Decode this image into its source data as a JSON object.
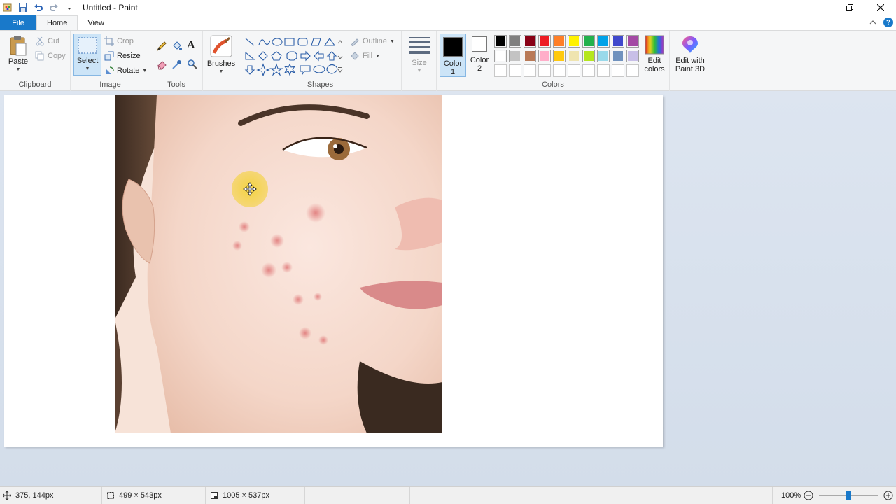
{
  "window": {
    "title": "Untitled - Paint"
  },
  "tabs": {
    "file": "File",
    "home": "Home",
    "view": "View"
  },
  "clipboard": {
    "label": "Clipboard",
    "paste": "Paste",
    "cut": "Cut",
    "copy": "Copy"
  },
  "image": {
    "label": "Image",
    "select": "Select",
    "crop": "Crop",
    "resize": "Resize",
    "rotate": "Rotate"
  },
  "tools": {
    "label": "Tools"
  },
  "brushes": {
    "label": "Brushes"
  },
  "shapes": {
    "label": "Shapes",
    "outline": "Outline",
    "fill": "Fill"
  },
  "size": {
    "label": "Size"
  },
  "colors": {
    "label": "Colors",
    "color1_label": "Color",
    "color1_num": "1",
    "color2_label": "Color",
    "color2_num": "2",
    "color1": "#000000",
    "color2": "#ffffff",
    "edit_colors_line1": "Edit",
    "edit_colors_line2": "colors",
    "palette_row1": [
      "#000000",
      "#7f7f7f",
      "#880015",
      "#ed1c24",
      "#ff7f27",
      "#fff200",
      "#22b14c",
      "#00a2e8",
      "#3f48cc",
      "#a349a4"
    ],
    "palette_row2": [
      "#ffffff",
      "#c3c3c3",
      "#b97a57",
      "#ffaec9",
      "#ffc90e",
      "#efe4b0",
      "#b5e61d",
      "#99d9ea",
      "#7092be",
      "#c8bfe7"
    ]
  },
  "paint3d": {
    "line1": "Edit with",
    "line2": "Paint 3D"
  },
  "status": {
    "cursor_pos": "375, 144px",
    "selection_size": "499 × 543px",
    "canvas_size": "1005 × 537px",
    "zoom": "100%",
    "zoom_level": 0.5
  }
}
